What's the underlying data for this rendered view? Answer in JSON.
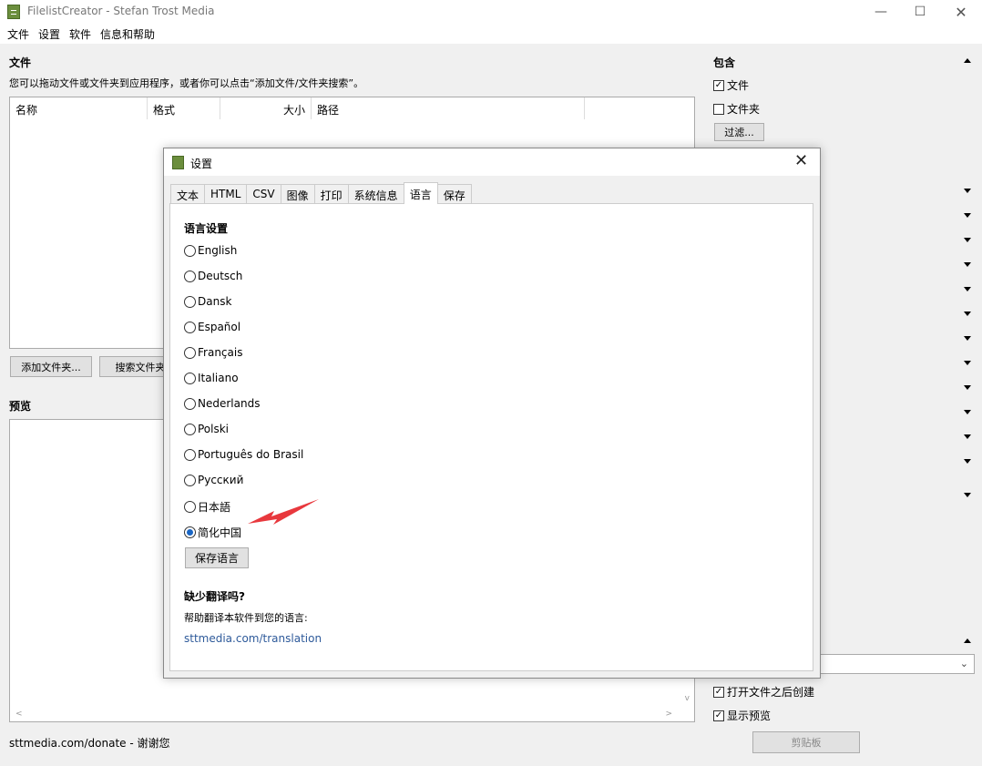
{
  "window": {
    "title": "FilelistCreator - Stefan Trost Media",
    "minimize": "—",
    "maximize": "☐",
    "close": "✕"
  },
  "menu": [
    "文件",
    "设置",
    "软件",
    "信息和帮助"
  ],
  "files": {
    "label": "文件",
    "hint": "您可以拖动文件或文件夹到应用程序，或者你可以点击“添加文件/文件夹搜索”。",
    "columns": [
      "名称",
      "格式",
      "大小",
      "路径"
    ],
    "add_folder_button": "添加文件夹...",
    "search_folder_button": "搜索文件夹"
  },
  "preview": {
    "label": "预览"
  },
  "footer": {
    "text": "sttmedia.com/donate - 谢谢您"
  },
  "right_panel": {
    "include_label": "包含",
    "include_files": {
      "label": "文件",
      "checked": true
    },
    "include_folders": {
      "label": "文件夹",
      "checked": false
    },
    "filter_button": "过滤...",
    "create_after_open": {
      "label": "打开文件之后创建",
      "checked": true
    },
    "show_preview": {
      "label": "显示预览",
      "checked": true
    },
    "clipboard_button": "剪贴板"
  },
  "dialog": {
    "title": "设置",
    "close": "✕",
    "tabs": [
      "文本",
      "HTML",
      "CSV",
      "图像",
      "打印",
      "系统信息",
      "语言",
      "保存"
    ],
    "active_tab": "语言",
    "language_header": "语言设置",
    "languages": [
      "English",
      "Deutsch",
      "Dansk",
      "Español",
      "Français",
      "Italiano",
      "Nederlands",
      "Polski",
      "Português do Brasil",
      "Русский",
      "日本語",
      "简化中国"
    ],
    "selected_language": "简化中国",
    "save_button": "保存语言",
    "missing_title": "缺少翻译吗?",
    "help_text": "帮助翻译本软件到您的语言:",
    "link": "sttmedia.com/translation"
  },
  "colors": {
    "accent": "#1a66c4",
    "link": "#2e5a9a",
    "arrow": "#e8383d"
  }
}
